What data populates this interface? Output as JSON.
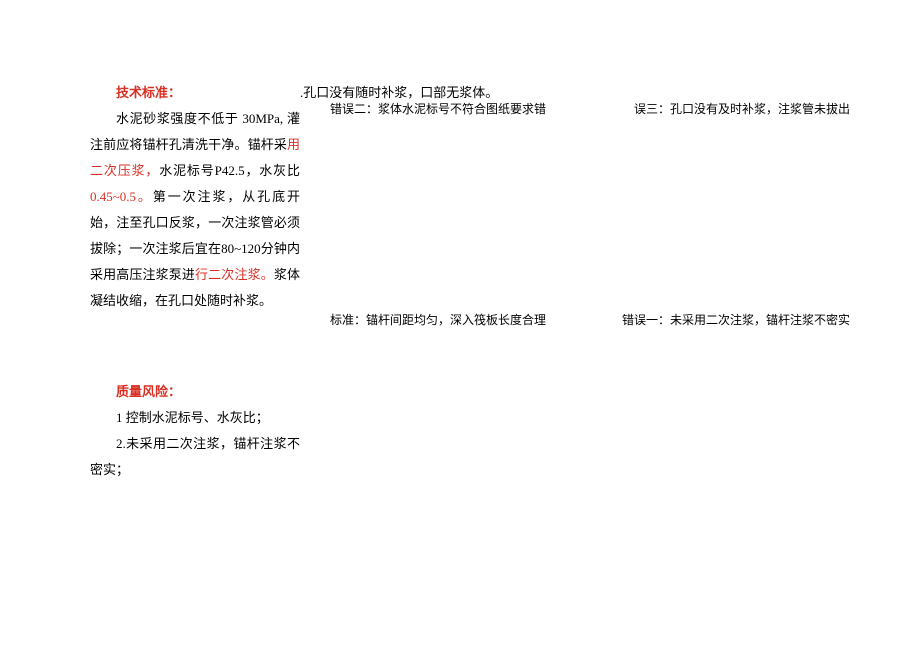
{
  "top_note": ".孔口没有随时补浆，口部无浆体。",
  "tech": {
    "title": "技术标准：",
    "p_before_1": "水泥砂浆强度不低于 30MPa, 灌注前应将锚杆孔清洗干净。锚杆采",
    "p_red_1": "用二次压浆，",
    "p_mid": "水泥标号P42.5，水灰比",
    "p_red_2": "0.45~0.5。",
    "p_after_2": "第一次注浆，从孔底开始，注至孔口反浆，一次注浆管必须拔除；一次注浆后宜在80~120分钟内采用高压注浆泵进",
    "p_red_3": "行二次注浆。",
    "p_end": "浆体凝结收缩，在孔口处随时补浆。"
  },
  "risk": {
    "title": "质量风险：",
    "item1": "1 控制水泥标号、水灰比；",
    "item2": "2.未采用二次注浆，锚杆注浆不密实；"
  },
  "captions": {
    "err2": "错误二：浆体水泥标号不符合图纸要求错",
    "err3": "误三：孔口没有及时补浆，注浆管未拔出",
    "std": "标准：锚杆间距均匀，深入筏板长度合理",
    "err1": "错误一：未采用二次注浆，锚杆注浆不密实"
  }
}
